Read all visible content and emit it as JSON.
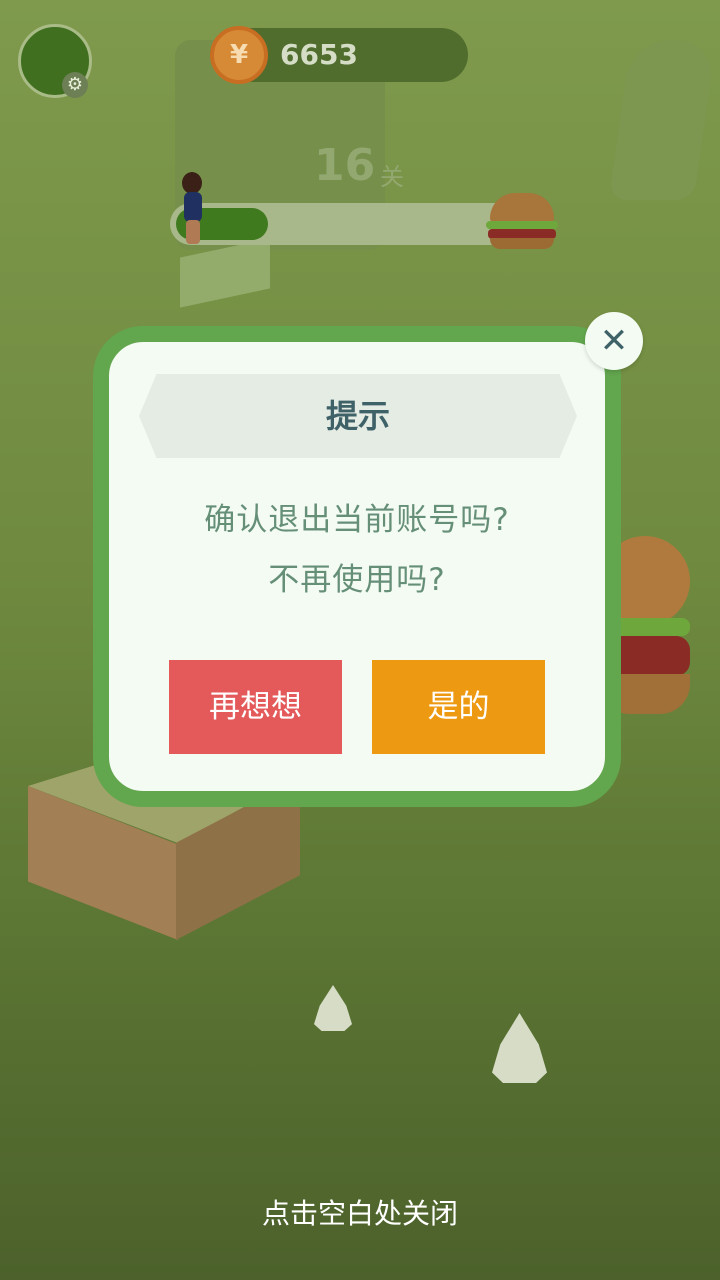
{
  "hud": {
    "coins": "6653",
    "coin_symbol": "¥",
    "level_number": "16",
    "level_unit": "关",
    "progress": 0.25
  },
  "dialog": {
    "title": "提示",
    "message_line1": "确认退出当前账号吗?",
    "message_line2": "不再使用吗?",
    "cancel_label": "再想想",
    "confirm_label": "是的",
    "close_glyph": "✕"
  },
  "footer": {
    "hint": "点击空白处关闭"
  },
  "colors": {
    "dialog_border": "#62a64e",
    "cancel_button": "#e45a5a",
    "confirm_button": "#ed9a12",
    "title_text": "#3f6168",
    "message_text": "#668f78"
  },
  "icons": {
    "settings": "gear-icon",
    "close": "close-icon",
    "currency": "coin-icon"
  }
}
